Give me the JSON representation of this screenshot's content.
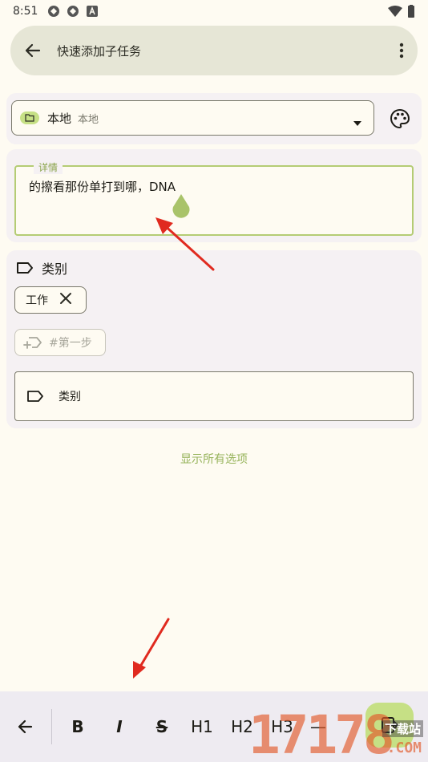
{
  "status_bar": {
    "time": "8:51"
  },
  "top_bar": {
    "title": "快速添加子任务"
  },
  "location": {
    "name": "本地",
    "subtitle": "本地"
  },
  "detail": {
    "label": "详情",
    "text": "的擦看那份单打到哪，DNA"
  },
  "category": {
    "title": "类别",
    "chips": [
      {
        "label": "工作"
      }
    ],
    "add_chip_placeholder": "#第一步",
    "input_placeholder": "类别"
  },
  "show_all_label": "显示所有选项",
  "toolbar": {
    "bold": "B",
    "italic": "I",
    "strike": "S",
    "h1": "H1",
    "h2": "H2",
    "h3": "H3",
    "hr": "—"
  },
  "watermark": {
    "number": "17178",
    "cn": "下载站",
    "com": ".COM"
  },
  "colors": {
    "accent": "#c6e085",
    "outline_focus": "#b4cc74",
    "arrow": "#e02a1f"
  }
}
